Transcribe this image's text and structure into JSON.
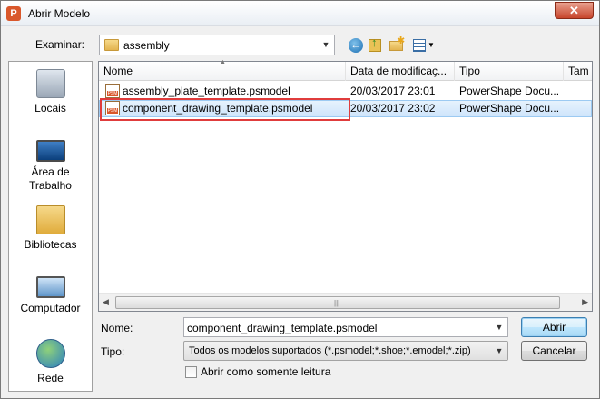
{
  "window": {
    "title": "Abrir Modelo",
    "app_icon_letter": "P",
    "close_glyph": "✕"
  },
  "lookin": {
    "label": "Examinar:",
    "value": "assembly"
  },
  "places": [
    {
      "label": "Locais"
    },
    {
      "label": "Área de Trabalho"
    },
    {
      "label": "Bibliotecas"
    },
    {
      "label": "Computador"
    },
    {
      "label": "Rede"
    }
  ],
  "filelist": {
    "columns": [
      "Nome",
      "Data de modificaç...",
      "Tipo",
      "Tam"
    ],
    "rows": [
      {
        "name": "assembly_plate_template.psmodel",
        "date": "20/03/2017 23:01",
        "type": "PowerShape Docu..."
      },
      {
        "name": "component_drawing_template.psmodel",
        "date": "20/03/2017 23:02",
        "type": "PowerShape Docu..."
      }
    ],
    "selected_index": 1,
    "file_icon_text": "PSM"
  },
  "name_field": {
    "label": "Nome:",
    "value": "component_drawing_template.psmodel"
  },
  "type_field": {
    "label": "Tipo:",
    "value": "Todos os modelos suportados (*.psmodel;*.shoe;*.emodel;*.zip)"
  },
  "readonly_checkbox": {
    "label": "Abrir como somente leitura",
    "checked": false
  },
  "buttons": {
    "open": "Abrir",
    "cancel": "Cancelar"
  },
  "icons": {
    "back": "back-icon",
    "up": "up-folder-icon",
    "new_folder": "new-folder-icon",
    "view": "view-menu-icon"
  },
  "colors": {
    "selection": "#cfe5fb",
    "highlight_box": "#e03c3c"
  }
}
